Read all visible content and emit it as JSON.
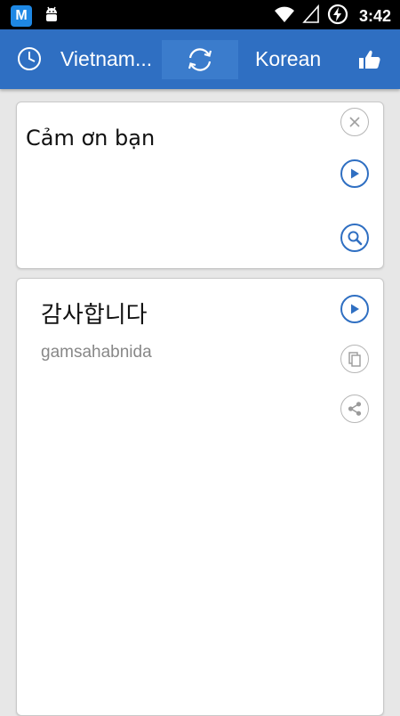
{
  "status_bar": {
    "time": "3:42",
    "app_icon_letter": "M",
    "icons": [
      "app-m-icon",
      "android-debug-icon",
      "wifi-icon",
      "signal-icon",
      "battery-charging-icon"
    ]
  },
  "toolbar": {
    "source_language": "Vietnam...",
    "target_language": "Korean",
    "icons": [
      "history-icon",
      "swap-icon",
      "thumbs-up-icon"
    ]
  },
  "input": {
    "text": "Cảm ơn bạn",
    "icons": [
      "clear-icon",
      "play-icon",
      "search-icon"
    ]
  },
  "output": {
    "translation": "감사합니다",
    "romanization": "gamsahabnida",
    "icons": [
      "play-icon",
      "copy-icon",
      "share-icon"
    ]
  },
  "colors": {
    "toolbar": "#2f6fc2",
    "accent": "#2f6fc2",
    "background": "#e7e7e7"
  }
}
